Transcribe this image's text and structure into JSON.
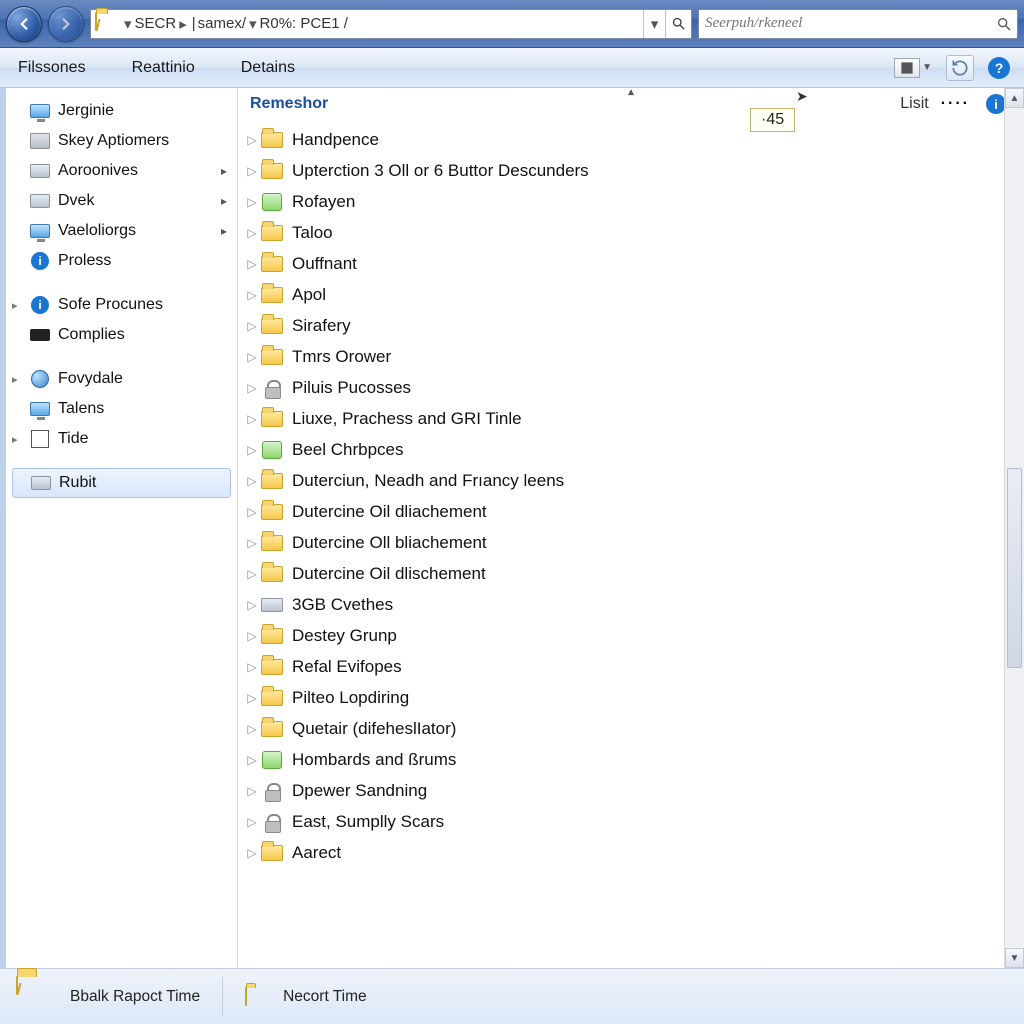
{
  "address": {
    "segments": [
      "SECR",
      "samex/",
      "R0%: PCE1 /"
    ]
  },
  "search": {
    "placeholder": "Seerpuh/rkeneel"
  },
  "commands": {
    "c0": "Filssones",
    "c1": "Reattinio",
    "c2": "Detains"
  },
  "sidebar": {
    "g0": [
      {
        "label": "Jerginie",
        "icon": "monic"
      },
      {
        "label": "Skey Aptiomers",
        "icon": "printic"
      },
      {
        "label": "Aoroonives",
        "icon": "driveic",
        "hasSub": true
      },
      {
        "label": "Dvek",
        "icon": "driveic",
        "hasSub": true
      },
      {
        "label": "Vaeloliorgs",
        "icon": "monic",
        "hasSub": true
      },
      {
        "label": "Proless",
        "icon": "infoic"
      }
    ],
    "g1": [
      {
        "label": "Sofe Procunes",
        "icon": "infoic",
        "exp": true
      },
      {
        "label": "Complies",
        "icon": "blackic"
      }
    ],
    "g2": [
      {
        "label": "Fovydale",
        "icon": "globeic",
        "exp": true
      },
      {
        "label": "Talens",
        "icon": "monic"
      },
      {
        "label": "Tide",
        "icon": "boxic",
        "exp": true
      }
    ],
    "selected": {
      "label": "Rubit",
      "icon": "driveic"
    }
  },
  "main": {
    "header": {
      "name": "Remeshor",
      "list": "Lisit"
    },
    "valueBox": "·45",
    "items": [
      {
        "label": "Handpence",
        "icon": "folder"
      },
      {
        "label": "Upterction 3 Oll or 6 Buttor Descunders",
        "icon": "folder"
      },
      {
        "label": "Rofayen",
        "icon": "appic"
      },
      {
        "label": "Taloo",
        "icon": "folder"
      },
      {
        "label": "Ouffnant",
        "icon": "folder"
      },
      {
        "label": "Apol",
        "icon": "folder"
      },
      {
        "label": "Sirafery",
        "icon": "folder"
      },
      {
        "label": "Tmrs Orower",
        "icon": "folder"
      },
      {
        "label": "Piluis Pucosses",
        "icon": "lockic"
      },
      {
        "label": "Liuxe, Prachess and GRI Tinle",
        "icon": "folder"
      },
      {
        "label": "Beel Chrbpces",
        "icon": "appic"
      },
      {
        "label": "Duterciun, Neadh and Frıancy leens",
        "icon": "folder"
      },
      {
        "label": "Dutercine Oil dliachement",
        "icon": "folder"
      },
      {
        "label": "Dutercine Oll bliachement",
        "icon": "folder"
      },
      {
        "label": "Dutercine Oil dlischement",
        "icon": "folder"
      },
      {
        "label": "3GB Cvethes",
        "icon": "driveic"
      },
      {
        "label": "Destey Grunp",
        "icon": "folder"
      },
      {
        "label": "Refal Evifopes",
        "icon": "folder"
      },
      {
        "label": "Pilteo Lopdiring",
        "icon": "folder"
      },
      {
        "label": "Quetair (difeheslIator)",
        "icon": "folder"
      },
      {
        "label": "Hombards and ßrums",
        "icon": "appic"
      },
      {
        "label": "Dpewer Sandning",
        "icon": "lockic"
      },
      {
        "label": "East, Sumplly Scars",
        "icon": "lockic"
      },
      {
        "label": "Aarect",
        "icon": "folder"
      }
    ]
  },
  "details": {
    "d0": "Bbalk Rapoct Time",
    "d1": "Necort Time"
  }
}
